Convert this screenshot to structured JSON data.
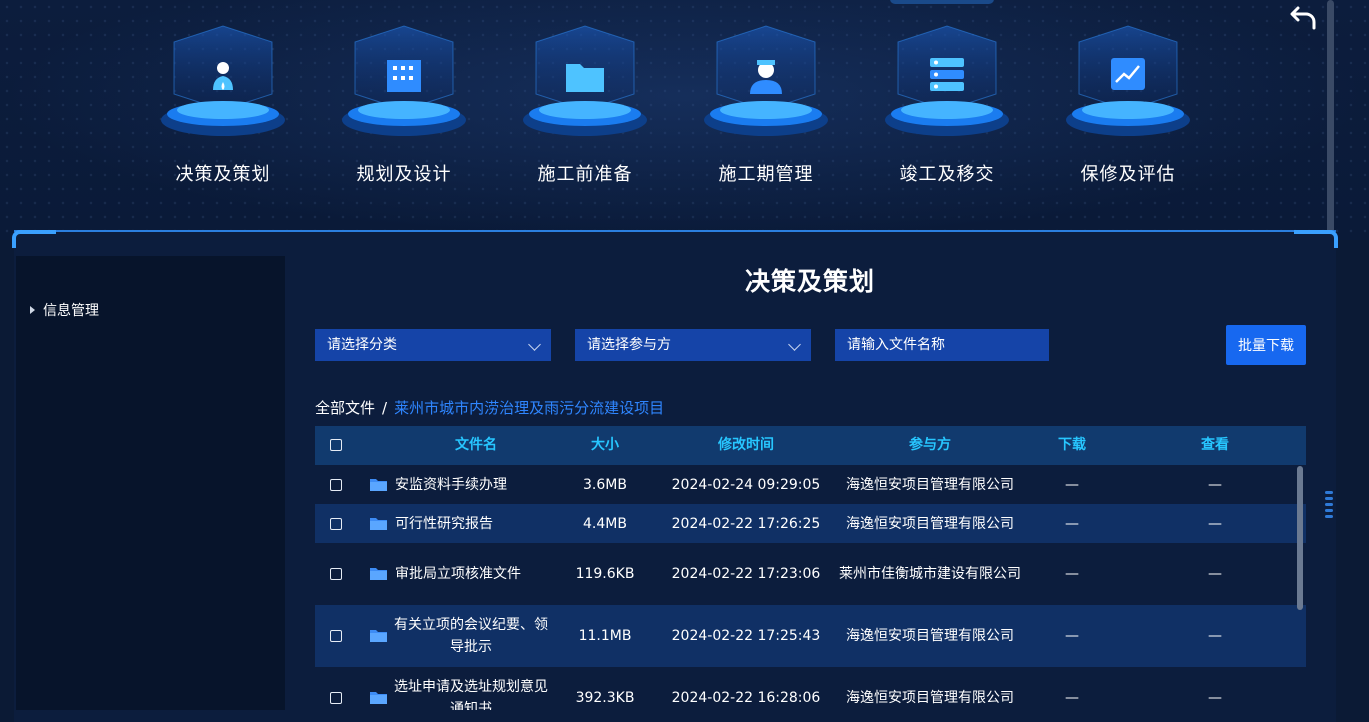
{
  "nav": {
    "items": [
      {
        "label": "决策及策划",
        "icon": "user-water-icon"
      },
      {
        "label": "规划及设计",
        "icon": "building-icon"
      },
      {
        "label": "施工前准备",
        "icon": "folder-icon"
      },
      {
        "label": "施工期管理",
        "icon": "worker-icon"
      },
      {
        "label": "竣工及移交",
        "icon": "server-icon"
      },
      {
        "label": "保修及评估",
        "icon": "chart-icon"
      }
    ]
  },
  "sidebar": {
    "items": [
      {
        "label": "信息管理"
      }
    ]
  },
  "main": {
    "title": "决策及策划",
    "filters": {
      "category_placeholder": "请选择分类",
      "party_placeholder": "请选择参与方",
      "filename_placeholder": "请输入文件名称"
    },
    "batch_download": "批量下载",
    "breadcrumb": {
      "root": "全部文件",
      "separator": "/",
      "current": "莱州市城市内涝治理及雨污分流建设项目"
    },
    "table": {
      "headers": {
        "name": "文件名",
        "size": "大小",
        "modified": "修改时间",
        "party": "参与方",
        "download": "下载",
        "view": "查看"
      },
      "rows": [
        {
          "name": "安监资料手续办理",
          "size": "3.6MB",
          "modified": "2024-02-24 09:29:05",
          "party": "海逸恒安项目管理有限公司",
          "download": "—",
          "view": "—"
        },
        {
          "name": "可行性研究报告",
          "size": "4.4MB",
          "modified": "2024-02-22 17:26:25",
          "party": "海逸恒安项目管理有限公司",
          "download": "—",
          "view": "—"
        },
        {
          "name": "审批局立项核准文件",
          "size": "119.6KB",
          "modified": "2024-02-22 17:23:06",
          "party": "莱州市佳衡城市建设有限公司",
          "download": "—",
          "view": "—"
        },
        {
          "name": "有关立项的会议纪要、领导批示",
          "size": "11.1MB",
          "modified": "2024-02-22 17:25:43",
          "party": "海逸恒安项目管理有限公司",
          "download": "—",
          "view": "—"
        },
        {
          "name": "选址申请及选址规划意见通知书",
          "size": "392.3KB",
          "modified": "2024-02-22 16:28:06",
          "party": "海逸恒安项目管理有限公司",
          "download": "—",
          "view": "—"
        }
      ]
    }
  },
  "colors": {
    "accent": "#1768f0",
    "header_text": "#27c6ff",
    "link": "#2f86ff",
    "select_bg": "#1544a8"
  }
}
